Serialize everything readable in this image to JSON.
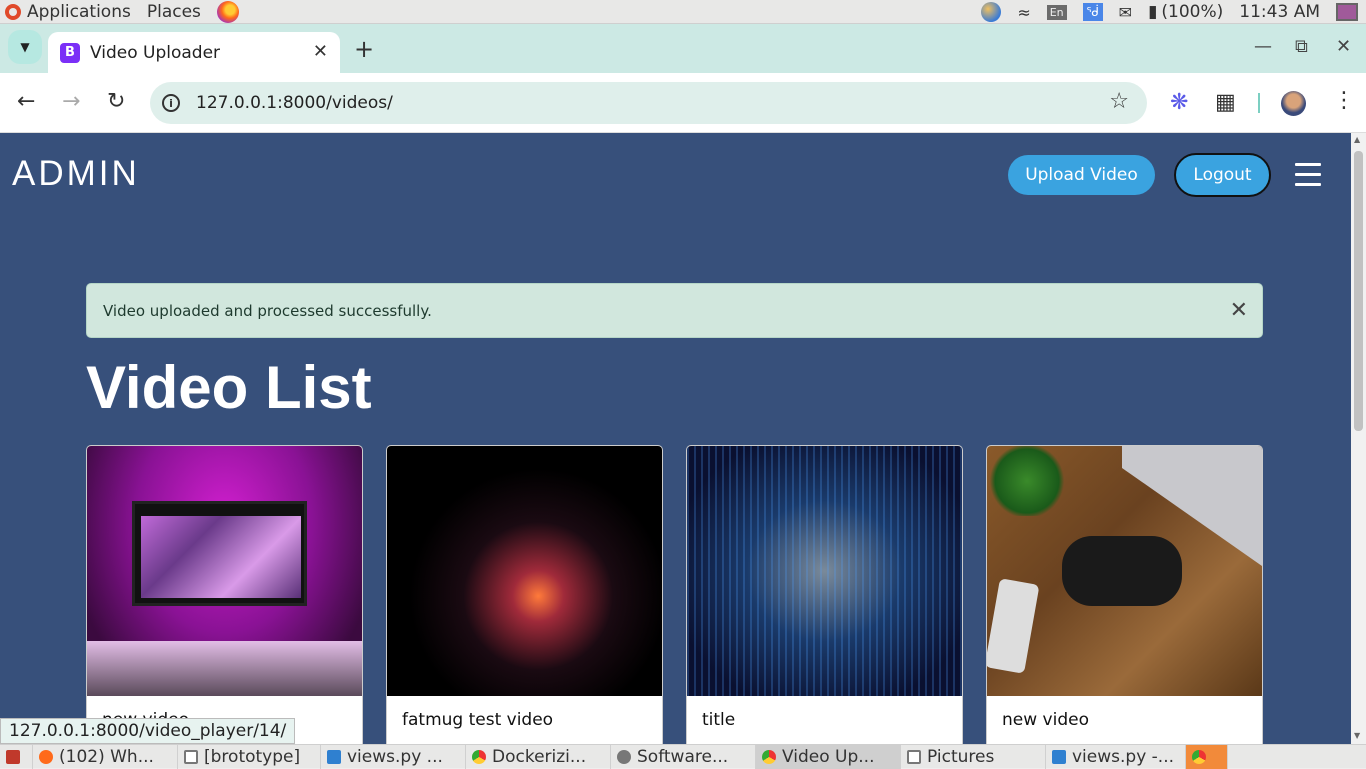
{
  "os_bar": {
    "menu": [
      "Applications",
      "Places"
    ],
    "language": "En",
    "battery": "(100%)",
    "clock": "11:43 AM"
  },
  "browser": {
    "tab_title": "Video Uploader",
    "tab_favicon_letter": "B",
    "url": "127.0.0.1:8000/videos/",
    "status_url": "127.0.0.1:8000/video_player/14/"
  },
  "navbar": {
    "brand": "ADMIN",
    "upload_label": "Upload Video",
    "logout_label": "Logout"
  },
  "alert": {
    "message": "Video uploaded and processed successfully."
  },
  "main": {
    "heading": "Video List",
    "videos": [
      {
        "title": "new video"
      },
      {
        "title": "fatmug test video"
      },
      {
        "title": "title"
      },
      {
        "title": "new video"
      }
    ]
  },
  "taskbar": [
    {
      "label": "(102) Wh..."
    },
    {
      "label": "[brototype]"
    },
    {
      "label": "views.py ..."
    },
    {
      "label": "Dockerizi..."
    },
    {
      "label": "Software..."
    },
    {
      "label": "Video Up..."
    },
    {
      "label": "Pictures"
    },
    {
      "label": "views.py -..."
    }
  ],
  "colors": {
    "page_bg": "#37507b",
    "button": "#3aa3e0",
    "alert_bg": "#d1e7dd"
  }
}
